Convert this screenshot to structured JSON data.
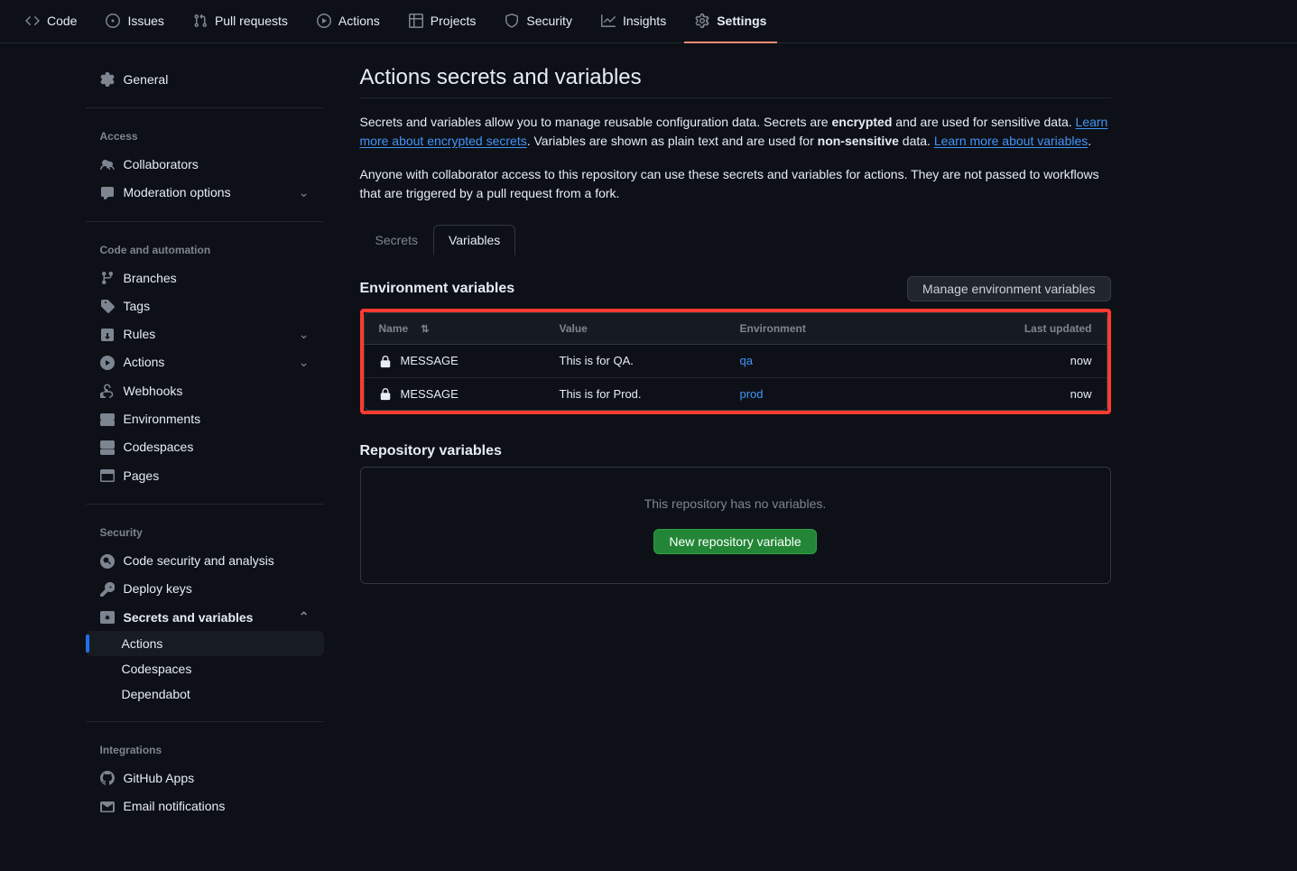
{
  "topnav": {
    "code": "Code",
    "issues": "Issues",
    "pull_requests": "Pull requests",
    "actions": "Actions",
    "projects": "Projects",
    "security": "Security",
    "insights": "Insights",
    "settings": "Settings"
  },
  "sidebar": {
    "general": "General",
    "access_heading": "Access",
    "collaborators": "Collaborators",
    "moderation": "Moderation options",
    "code_heading": "Code and automation",
    "branches": "Branches",
    "tags": "Tags",
    "rules": "Rules",
    "actions": "Actions",
    "webhooks": "Webhooks",
    "environments": "Environments",
    "codespaces": "Codespaces",
    "pages": "Pages",
    "security_heading": "Security",
    "code_security": "Code security and analysis",
    "deploy_keys": "Deploy keys",
    "secrets_vars": "Secrets and variables",
    "sub_actions": "Actions",
    "sub_codespaces": "Codespaces",
    "sub_dependabot": "Dependabot",
    "integrations_heading": "Integrations",
    "github_apps": "GitHub Apps",
    "email_notifications": "Email notifications"
  },
  "page_title": "Actions secrets and variables",
  "desc": {
    "p1_a": "Secrets and variables allow you to manage reusable configuration data. Secrets are ",
    "p1_b": "encrypted",
    "p1_c": " and are used for sensitive data. ",
    "p1_link1": "Learn more about encrypted secrets",
    "p1_d": ". Variables are shown as plain text and are used for ",
    "p1_e": "non-sensitive",
    "p1_f": " data. ",
    "p1_link2": "Learn more about variables",
    "p1_g": ".",
    "p2": "Anyone with collaborator access to this repository can use these secrets and variables for actions. They are not passed to workflows that are triggered by a pull request from a fork."
  },
  "tabs": {
    "secrets": "Secrets",
    "variables": "Variables"
  },
  "env_section": {
    "title": "Environment variables",
    "manage_btn": "Manage environment variables"
  },
  "table": {
    "headers": {
      "name": "Name",
      "value": "Value",
      "environment": "Environment",
      "last_updated": "Last updated"
    },
    "rows": [
      {
        "name": "MESSAGE",
        "value": "This is for QA.",
        "env": "qa",
        "updated": "now"
      },
      {
        "name": "MESSAGE",
        "value": "This is for Prod.",
        "env": "prod",
        "updated": "now"
      }
    ]
  },
  "repo_section": {
    "title": "Repository variables",
    "empty_text": "This repository has no variables.",
    "new_btn": "New repository variable"
  }
}
